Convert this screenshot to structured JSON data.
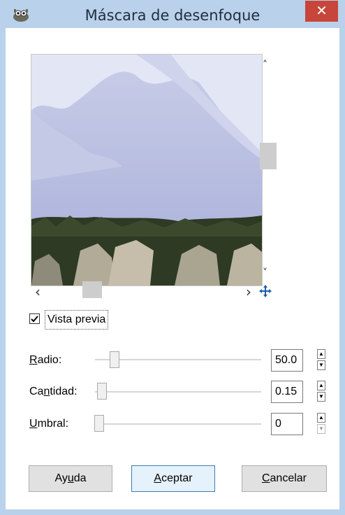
{
  "window": {
    "title": "Máscara de desenfoque",
    "close_glyph": "✕",
    "app_icon": "gimp-wilber-icon"
  },
  "preview": {
    "checkbox_label": "Vista previa",
    "checked": true,
    "scroll_up": "˄",
    "scroll_down": "˅",
    "scroll_left": "‹",
    "scroll_right": "›",
    "navigate_icon": "move-arrows-icon"
  },
  "params": [
    {
      "label_mnemonic": "R",
      "label_rest": "adio:",
      "value": "50.0",
      "fraction": 0.15
    },
    {
      "label_mnemonic_prefix": "Ca",
      "label_mnemonic": "n",
      "label_rest": "tidad:",
      "value": "0.15",
      "fraction": 0.02
    },
    {
      "label_mnemonic": "U",
      "label_rest": "mbral:",
      "value": "0",
      "fraction": 0.0
    }
  ],
  "buttons": {
    "help_prefix": "Ay",
    "help_mnemonic": "u",
    "help_rest": "da",
    "ok_mnemonic": "A",
    "ok_rest": "ceptar",
    "cancel_mnemonic": "C",
    "cancel_rest": "ancelar"
  },
  "colors": {
    "frame": "#b9d1ea",
    "close": "#c7453a",
    "sky": "#a9b2dc",
    "snow": "#e4e8f6",
    "forest": "#2e3a24"
  }
}
